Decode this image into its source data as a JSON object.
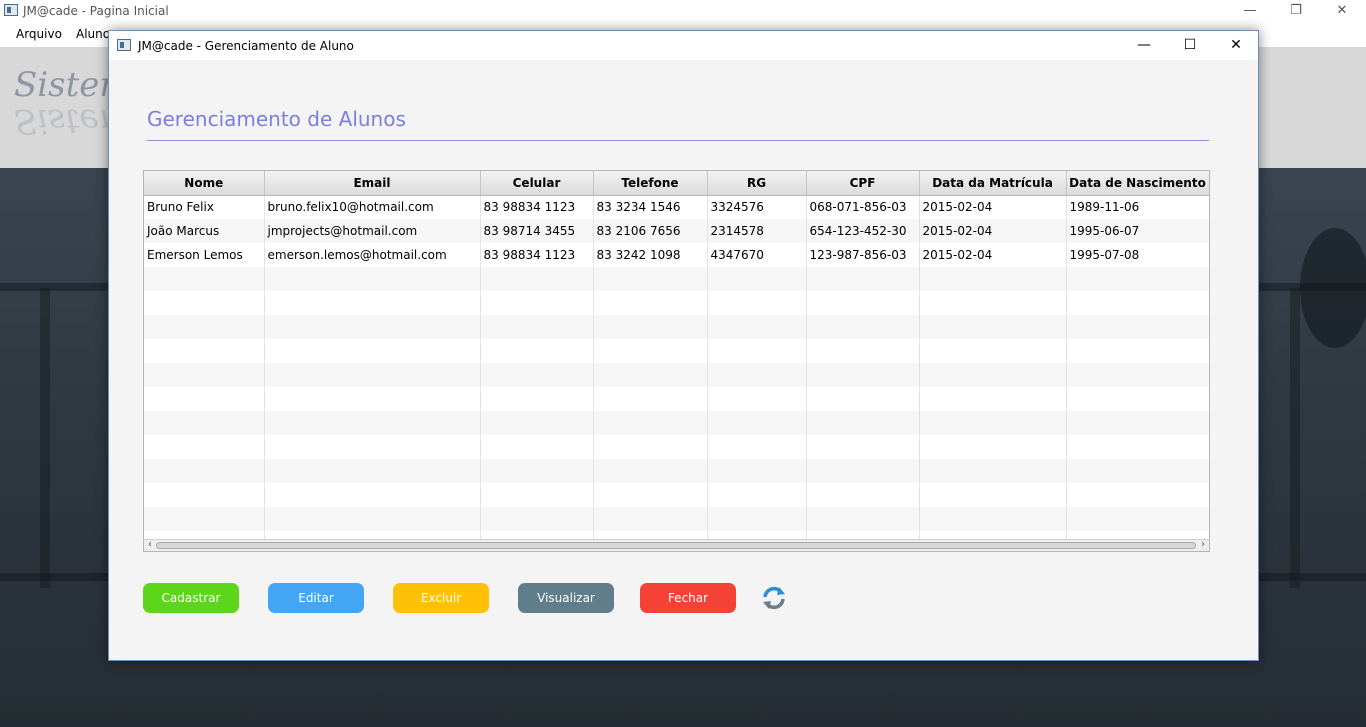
{
  "main_window": {
    "title": "JM@cade - Pagina Inicial",
    "menu": [
      "Arquivo",
      "Aluno"
    ],
    "header_title": "Sistem",
    "controls": {
      "minimize": "—",
      "maximize": "❐",
      "close": "✕"
    }
  },
  "dialog": {
    "title": "JM@cade - Gerenciamento de Aluno",
    "controls": {
      "minimize": "—",
      "maximize": "☐",
      "close": "✕"
    },
    "heading": "Gerenciamento de Alunos",
    "table": {
      "columns": [
        "Nome",
        "Email",
        "Celular",
        "Telefone",
        "RG",
        "CPF",
        "Data da Matrícula",
        "Data de Nascimento"
      ],
      "rows": [
        [
          "Bruno Felix",
          "bruno.felix10@hotmail.com",
          "83 98834 1123",
          "83 3234 1546",
          "3324576",
          "068-071-856-03",
          "2015-02-04",
          "1989-11-06"
        ],
        [
          "João Marcus",
          "jmprojects@hotmail.com",
          "83 98714 3455",
          "83 2106 7656",
          "2314578",
          "654-123-452-30",
          "2015-02-04",
          "1995-06-07"
        ],
        [
          "Emerson Lemos",
          "emerson.lemos@hotmail.com",
          "83 98834 1123",
          "83 3242 1098",
          "4347670",
          "123-987-856-03",
          "2015-02-04",
          "1995-07-08"
        ]
      ],
      "empty_rows": 12
    },
    "buttons": {
      "cadastrar": "Cadastrar",
      "editar": "Editar",
      "excluir": "Excluir",
      "visualizar": "Visualizar",
      "fechar": "Fechar"
    },
    "refresh_icon": "refresh-icon"
  },
  "colors": {
    "heading": "#7a7fe0",
    "cadastrar": "#5dd51a",
    "editar": "#42a5f5",
    "excluir": "#ffc107",
    "visualizar": "#607d8b",
    "fechar": "#f44336"
  }
}
